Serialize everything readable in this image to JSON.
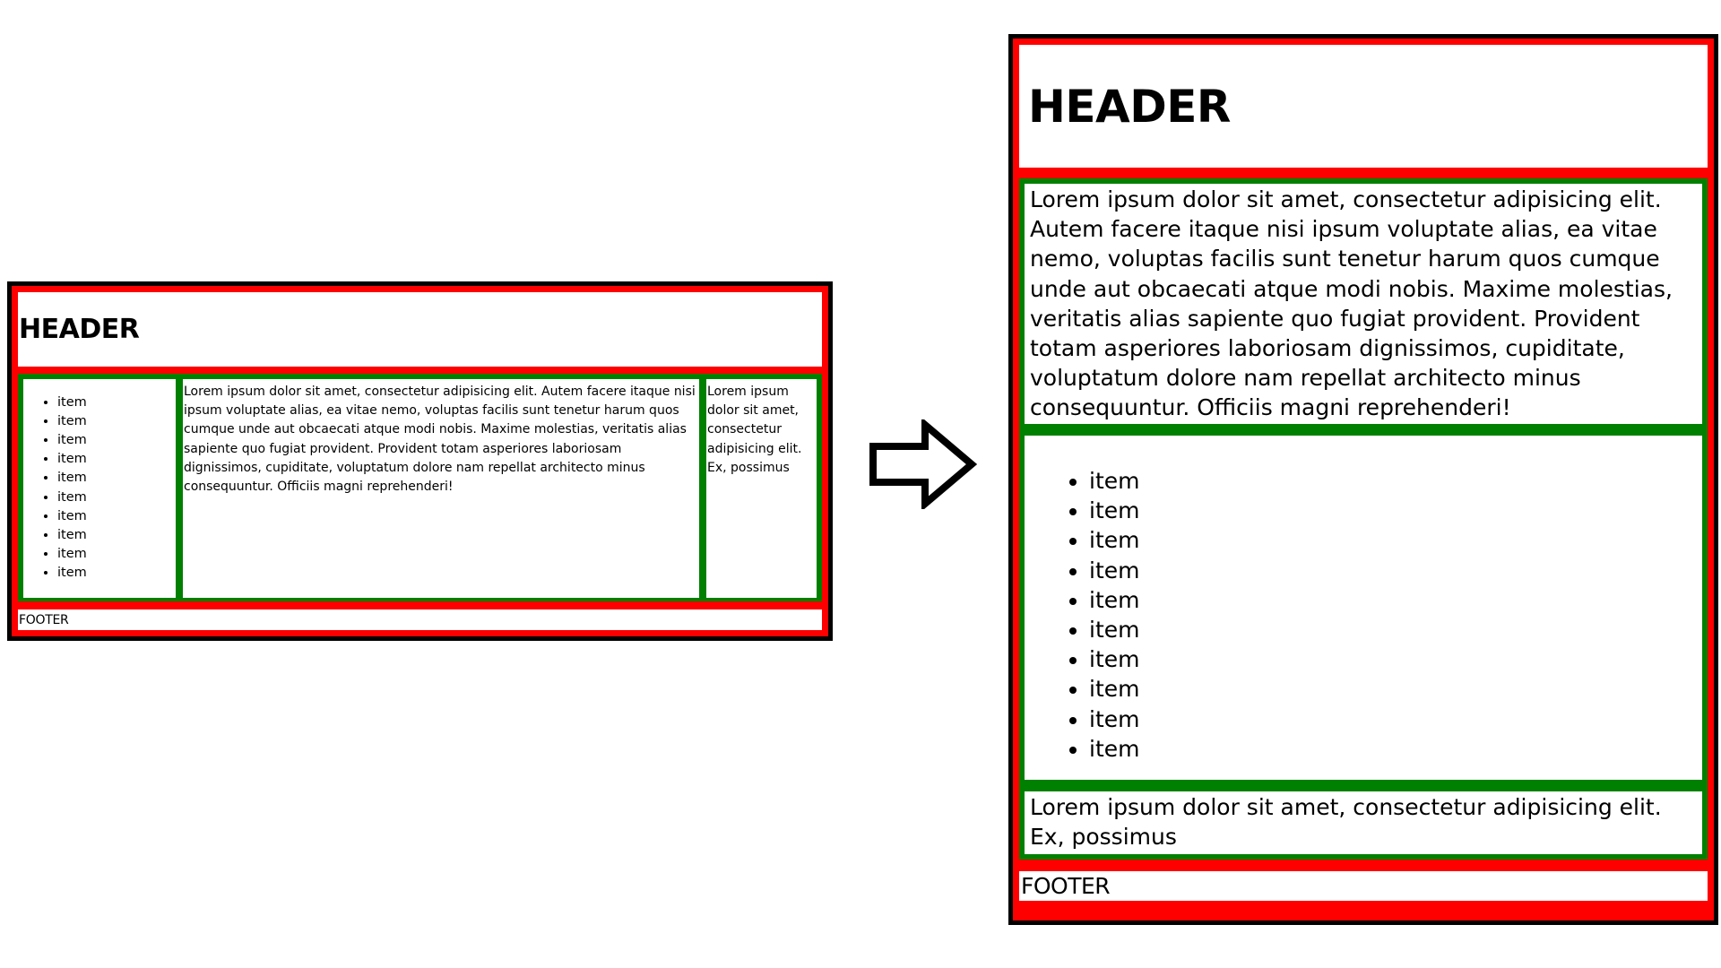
{
  "layouts": {
    "wide": {
      "header": "HEADER",
      "nav_items": [
        "item",
        "item",
        "item",
        "item",
        "item",
        "item",
        "item",
        "item",
        "item",
        "item"
      ],
      "content": "Lorem ipsum dolor sit amet, consectetur adipisicing elit. Autem facere itaque nisi ipsum voluptate alias, ea vitae nemo, voluptas facilis sunt tenetur harum quos cumque unde aut obcaecati atque modi nobis. Maxime molestias, veritatis alias sapiente quo fugiat provident. Provident totam asperiores laboriosam dignissimos, cupiditate, voluptatum dolore nam repellat architecto minus consequuntur. Officiis magni reprehenderi!",
      "aside": "Lorem ipsum dolor sit amet, consectetur adipisicing elit. Ex, possimus",
      "footer": "FOOTER"
    },
    "narrow": {
      "header": "HEADER",
      "content": "Lorem ipsum dolor sit amet, consectetur adipisicing elit. Autem facere itaque nisi ipsum voluptate alias, ea vitae nemo, voluptas facilis sunt tenetur harum quos cumque unde aut obcaecati atque modi nobis. Maxime molestias, veritatis alias sapiente quo fugiat provident. Provident totam asperiores laboriosam dignissimos, cupiditate, voluptatum dolore nam repellat architecto minus consequuntur. Officiis magni reprehenderi!",
      "nav_items": [
        "item",
        "item",
        "item",
        "item",
        "item",
        "item",
        "item",
        "item",
        "item",
        "item"
      ],
      "aside": "Lorem ipsum dolor sit amet, consectetur adipisicing elit. Ex, possimus",
      "footer": "FOOTER"
    }
  },
  "arrow_icon": "right-arrow-outline-icon",
  "colors": {
    "outer_border": "#000000",
    "header_footer_border": "#ff0000",
    "main_border": "#008000",
    "background": "#ffffff"
  }
}
